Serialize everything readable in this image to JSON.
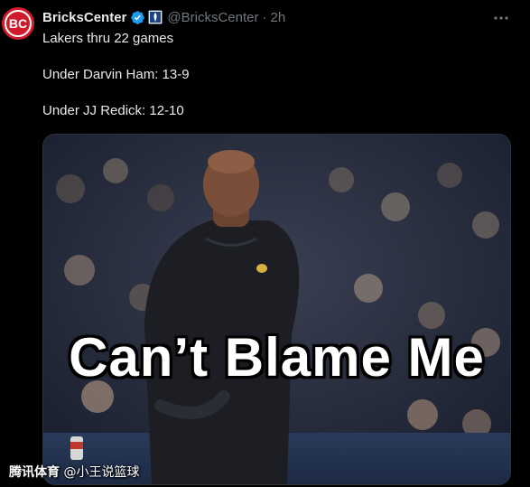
{
  "tweet": {
    "author_name": "BricksCenter",
    "avatar_text": "BC",
    "handle": "@BricksCenter",
    "separator": "·",
    "time": "2h",
    "lines": [
      "Lakers thru 22 games",
      "Under Darvin Ham: 13-9",
      "Under JJ Redick: 12-10"
    ],
    "media": {
      "caption": "Can’t Blame Me"
    }
  },
  "watermark": {
    "brand": "腾讯体育",
    "author": "@小王说篮球"
  },
  "colors": {
    "background": "#000000",
    "text": "#e7e9ea",
    "muted": "#71767b",
    "verified": "#1d9bf0",
    "avatar": "#cf1b2b"
  },
  "icons": [
    "verified-badge-icon",
    "affiliate-badge-icon",
    "more-options-icon"
  ]
}
